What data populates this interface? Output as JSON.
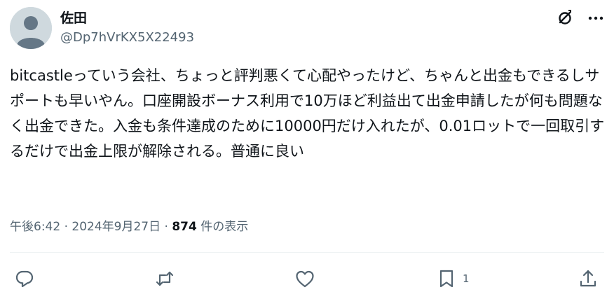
{
  "author": {
    "display_name": "佐田",
    "handle": "@Dp7hVrKX5X22493"
  },
  "icons": {
    "avatar": "default-avatar-icon",
    "grok": "grok-icon",
    "more": "more-options-icon",
    "reply": "reply-icon",
    "repost": "repost-icon",
    "like": "like-icon",
    "bookmark": "bookmark-icon",
    "share": "share-icon"
  },
  "tweet": {
    "text": "bitcastleっていう会社、ちょっと評判悪くて心配やったけど、ちゃんと出金もできるしサポートも早いやん。口座開設ボーナス利用で10万ほど利益出て出金申請したが何も問題なく出金できた。入金も条件達成のために10000円だけ入れたが、0.01ロットで一回取引するだけで出金上限が解除される。普通に良い"
  },
  "meta": {
    "time": "午後6:42",
    "separator": " · ",
    "date": "2024年9月27日",
    "views_count": "874",
    "views_label": " 件の表示"
  },
  "actions": {
    "bookmark_count": "1"
  },
  "colors": {
    "text_primary": "#0f1419",
    "text_secondary": "#536471",
    "avatar_bg": "#cfd9de",
    "avatar_fg": "#657786",
    "divider": "#eff3f4"
  }
}
